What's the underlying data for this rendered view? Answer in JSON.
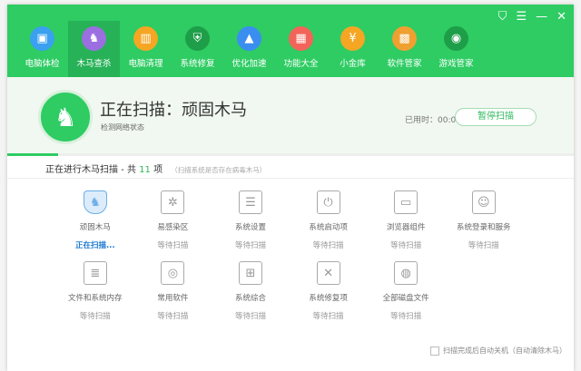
{
  "window_controls": [
    "skin-icon",
    "menu-icon",
    "minimize-icon",
    "close-icon"
  ],
  "nav": [
    {
      "label": "电脑体检",
      "icon": "monitor-icon",
      "color": "#3aa0f0",
      "glyph": "▣"
    },
    {
      "label": "木马查杀",
      "icon": "horse-icon",
      "color": "#9b6fe0",
      "glyph": "♞",
      "active": true
    },
    {
      "label": "电脑清理",
      "icon": "broom-icon",
      "color": "#f5a623",
      "glyph": "▥"
    },
    {
      "label": "系统修复",
      "icon": "shield-icon",
      "color": "#1e9e48",
      "glyph": "⛨"
    },
    {
      "label": "优化加速",
      "icon": "rocket-icon",
      "color": "#3a8ef0",
      "glyph": "▲"
    },
    {
      "label": "功能大全",
      "icon": "grid-icon",
      "color": "#f2645a",
      "glyph": "▦"
    },
    {
      "label": "小金库",
      "icon": "money-bag-icon",
      "color": "#f5a623",
      "glyph": "¥"
    },
    {
      "label": "软件管家",
      "icon": "apps-icon",
      "color": "#f0a030",
      "glyph": "▩"
    },
    {
      "label": "游戏管家",
      "icon": "gamepad-icon",
      "color": "#1e9e48",
      "glyph": "◉"
    }
  ],
  "status": {
    "title": "正在扫描：顽固木马",
    "subtitle": "检测网络状态",
    "elapsed": "已用时：00:00:01",
    "pause_label": "暂停扫描",
    "progress_percent": 9
  },
  "summary": {
    "prefix": "正在进行木马扫描 - 共",
    "count": "11",
    "suffix": "项",
    "hint": "（扫描系统是否存在病毒木马）"
  },
  "items": [
    {
      "label": "顽固木马",
      "status": "正在扫描...",
      "icon": "shield-horse-icon",
      "glyph": "♞",
      "active": true
    },
    {
      "label": "易感染区",
      "status": "等待扫描",
      "icon": "network-icon",
      "glyph": "✲"
    },
    {
      "label": "系统设置",
      "status": "等待扫描",
      "icon": "settings-monitor-icon",
      "glyph": "☰"
    },
    {
      "label": "系统启动项",
      "status": "等待扫描",
      "icon": "power-folder-icon",
      "glyph": "⏻"
    },
    {
      "label": "浏览器组件",
      "status": "等待扫描",
      "icon": "browser-icon",
      "glyph": "▭"
    },
    {
      "label": "系统登录和服务",
      "status": "等待扫描",
      "icon": "id-badge-icon",
      "glyph": "☺"
    },
    {
      "label": "文件和系统内存",
      "status": "等待扫描",
      "icon": "document-icon",
      "glyph": "≣"
    },
    {
      "label": "常用软件",
      "status": "等待扫描",
      "icon": "software-box-icon",
      "glyph": "◎"
    },
    {
      "label": "系统综合",
      "status": "等待扫描",
      "icon": "windows-icon",
      "glyph": "⊞"
    },
    {
      "label": "系统修复项",
      "status": "等待扫描",
      "icon": "tools-icon",
      "glyph": "✕"
    },
    {
      "label": "全部磁盘文件",
      "status": "等待扫描",
      "icon": "hard-disk-icon",
      "glyph": "◍"
    }
  ],
  "auto_shutdown": {
    "label": "扫描完成后自动关机（自动清除木马）",
    "checked": false
  }
}
